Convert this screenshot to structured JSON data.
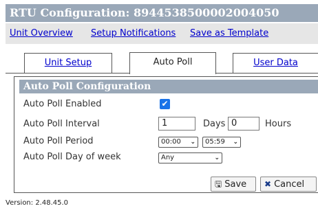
{
  "header": {
    "title": "RTU Configuration: 89445385000020040​50"
  },
  "links": {
    "unit_overview": "Unit Overview",
    "setup_notifications": "Setup Notifications",
    "save_as_template": "Save as Template"
  },
  "tabs": [
    {
      "label": "Unit Setup",
      "active": false
    },
    {
      "label": "Auto Poll",
      "active": true
    },
    {
      "label": "User Data",
      "active": false
    }
  ],
  "panel": {
    "title": "Auto Poll Configuration",
    "enabled_label": "Auto Poll Enabled",
    "enabled_checked": true,
    "interval_label": "Auto Poll Interval",
    "interval_days_value": "1",
    "interval_days_unit": "Days",
    "interval_hours_value": "0",
    "interval_hours_unit": "Hours",
    "period_label": "Auto Poll Period",
    "period_start": "00:00",
    "period_end": "05:59",
    "day_label": "Auto Poll Day of week",
    "day_value": "Any"
  },
  "buttons": {
    "save": "Save",
    "cancel": "Cancel"
  },
  "icons": {
    "save": "floppy-disk-icon",
    "cancel": "x-icon",
    "checkbox": "checkmark-icon",
    "dropdown": "chevron-down-icon"
  },
  "colors": {
    "header_bg": "#9aa8b8",
    "link": "#0000cc",
    "checkbox": "#1a73e8"
  },
  "footer": {
    "version": "Version: 2.48.45.0"
  }
}
